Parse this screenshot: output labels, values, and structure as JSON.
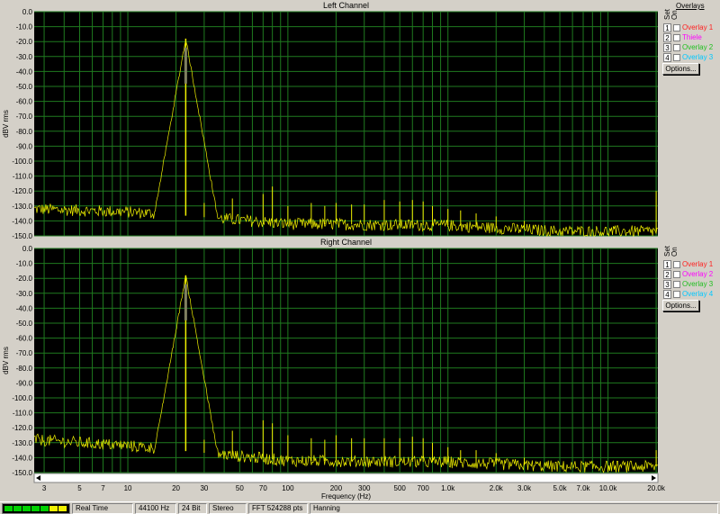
{
  "channels": [
    {
      "title": "Left Channel",
      "ylabel": "dBV rms",
      "overlays": [
        {
          "num": "1",
          "label": "Overlay 1",
          "color": "#ff2020"
        },
        {
          "num": "2",
          "label": "Thiele",
          "color": "#ff00ff"
        },
        {
          "num": "3",
          "label": "Overlay 2",
          "color": "#20c020"
        },
        {
          "num": "4",
          "label": "Overlay 3",
          "color": "#00c8ff"
        }
      ],
      "chart_data": {
        "type": "line",
        "yticks": [
          "0.0",
          "-10.0",
          "-20.0",
          "-30.0",
          "-40.0",
          "-50.0",
          "-60.0",
          "-70.0",
          "-80.0",
          "-90.0",
          "-100.0",
          "-110.0",
          "-120.0",
          "-130.0",
          "-140.0",
          "-150.0"
        ],
        "ylim": [
          -150,
          0
        ],
        "xscale": "log",
        "xlim": [
          2.6,
          20500
        ],
        "noise_floor": [
          [
            2.6,
            -132
          ],
          [
            10,
            -134
          ],
          [
            20,
            -136
          ],
          [
            100,
            -142
          ],
          [
            1000,
            -143
          ],
          [
            5000,
            -147
          ],
          [
            20000,
            -147
          ]
        ],
        "peaks": [
          [
            23,
            -18
          ],
          [
            30,
            -128
          ],
          [
            45,
            -125
          ],
          [
            70,
            -122
          ],
          [
            80,
            -117
          ],
          [
            100,
            -130
          ],
          [
            140,
            -128
          ],
          [
            170,
            -130
          ],
          [
            200,
            -128
          ],
          [
            250,
            -129
          ],
          [
            300,
            -129
          ],
          [
            400,
            -126
          ],
          [
            500,
            -127
          ],
          [
            600,
            -126
          ],
          [
            700,
            -127
          ],
          [
            800,
            -130
          ],
          [
            1000,
            -132
          ],
          [
            1200,
            -133
          ],
          [
            1500,
            -135
          ],
          [
            2000,
            -137
          ],
          [
            3000,
            -140
          ],
          [
            20000,
            -120
          ]
        ],
        "line_color": "#f0f000"
      }
    },
    {
      "title": "Right Channel",
      "ylabel": "dBV rms",
      "overlays": [
        {
          "num": "1",
          "label": "Overlay 1",
          "color": "#ff2020"
        },
        {
          "num": "2",
          "label": "Overlay 2",
          "color": "#ff00ff"
        },
        {
          "num": "3",
          "label": "Overlay 3",
          "color": "#20c020"
        },
        {
          "num": "4",
          "label": "Overlay 4",
          "color": "#00c8ff"
        }
      ],
      "chart_data": {
        "type": "line",
        "yticks": [
          "0.0",
          "-10.0",
          "-20.0",
          "-30.0",
          "-40.0",
          "-50.0",
          "-60.0",
          "-70.0",
          "-80.0",
          "-90.0",
          "-100.0",
          "-110.0",
          "-120.0",
          "-130.0",
          "-140.0",
          "-150.0"
        ],
        "ylim": [
          -150,
          0
        ],
        "xscale": "log",
        "xlim": [
          2.6,
          20500
        ],
        "noise_floor": [
          [
            2.6,
            -128
          ],
          [
            10,
            -132
          ],
          [
            20,
            -135
          ],
          [
            100,
            -142
          ],
          [
            1000,
            -143
          ],
          [
            5000,
            -146
          ],
          [
            20000,
            -146
          ]
        ],
        "peaks": [
          [
            23,
            -18
          ],
          [
            30,
            -128
          ],
          [
            45,
            -122
          ],
          [
            70,
            -115
          ],
          [
            80,
            -117
          ],
          [
            100,
            -125
          ],
          [
            140,
            -127
          ],
          [
            170,
            -128
          ],
          [
            200,
            -125
          ],
          [
            250,
            -127
          ],
          [
            300,
            -127
          ],
          [
            400,
            -127
          ],
          [
            500,
            -127
          ],
          [
            600,
            -126
          ],
          [
            700,
            -127
          ],
          [
            800,
            -130
          ],
          [
            1000,
            -133
          ],
          [
            1200,
            -135
          ],
          [
            1500,
            -135
          ],
          [
            2000,
            -137
          ],
          [
            3000,
            -140
          ],
          [
            20000,
            -135
          ]
        ],
        "line_color": "#f0f000"
      }
    }
  ],
  "xaxis": {
    "label": "Frequency (Hz)",
    "ticks": [
      {
        "v": 3,
        "t": "3"
      },
      {
        "v": 5,
        "t": "5"
      },
      {
        "v": 7,
        "t": "7"
      },
      {
        "v": 10,
        "t": "10"
      },
      {
        "v": 20,
        "t": "20"
      },
      {
        "v": 30,
        "t": "30"
      },
      {
        "v": 50,
        "t": "50"
      },
      {
        "v": 70,
        "t": "70"
      },
      {
        "v": 100,
        "t": "100"
      },
      {
        "v": 200,
        "t": "200"
      },
      {
        "v": 300,
        "t": "300"
      },
      {
        "v": 500,
        "t": "500"
      },
      {
        "v": 700,
        "t": "700"
      },
      {
        "v": 1000,
        "t": "1.0k"
      },
      {
        "v": 2000,
        "t": "2.0k"
      },
      {
        "v": 3000,
        "t": "3.0k"
      },
      {
        "v": 5000,
        "t": "5.0k"
      },
      {
        "v": 7000,
        "t": "7.0k"
      },
      {
        "v": 10000,
        "t": "10.0k"
      },
      {
        "v": 20000,
        "t": "20.0k"
      }
    ]
  },
  "overlays_panel": {
    "title": "Overlays",
    "set_label": "Set",
    "on_label": "On",
    "options_button": "Options..."
  },
  "statusbar": {
    "mode": "Real Time",
    "sample_rate": "44100 Hz",
    "bit_depth": "24 Bit",
    "channels": "Stereo",
    "fft": "FFT 524288 pts",
    "window": "Hanning",
    "meter_colors": [
      "#00d000",
      "#00d000",
      "#00d000",
      "#00d000",
      "#00d000",
      "#f0f000",
      "#f0f000"
    ]
  },
  "colors": {
    "plot_bg": "#000000",
    "grid": "#1f7a1f",
    "trace": "#f0f000"
  }
}
